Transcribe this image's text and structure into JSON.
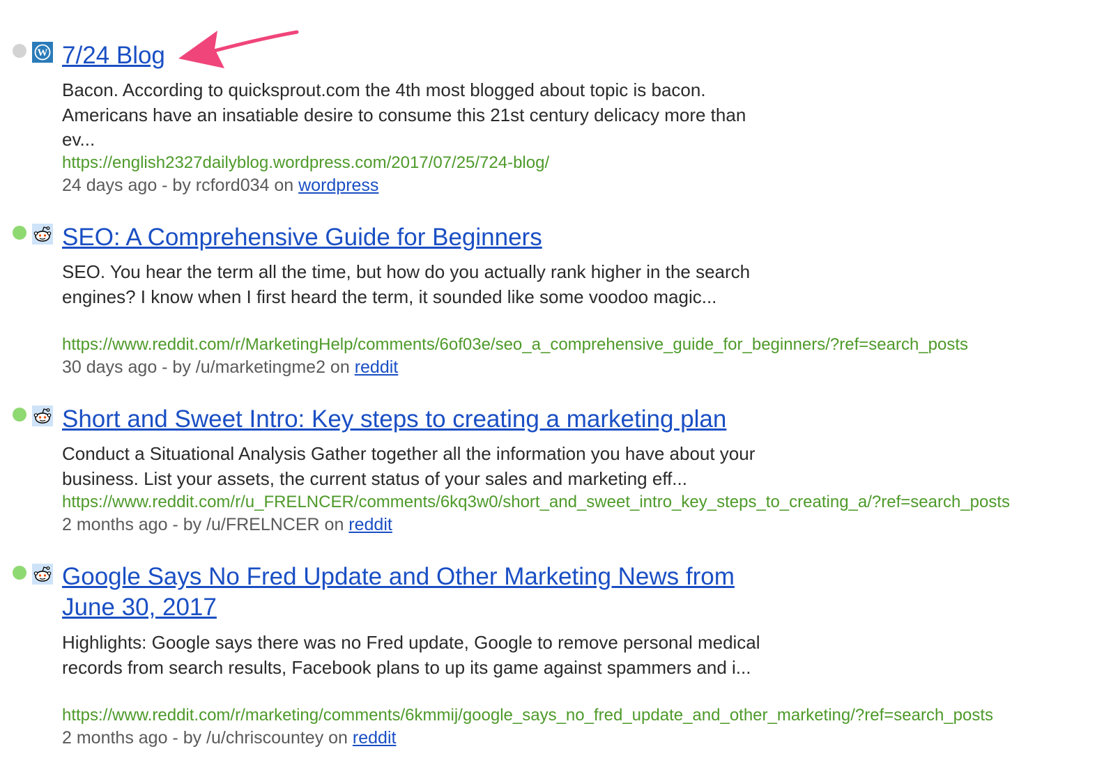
{
  "colors": {
    "title_link": "#1a4fc4",
    "url_green": "#4e9a2a",
    "dot_green": "#8fd972",
    "dot_grey": "#d3d3d3",
    "annotation_arrow": "#f0457a"
  },
  "results": [
    {
      "status": "grey",
      "source_icon": "wordpress-icon",
      "title": "7/24 Blog",
      "snippet": "Bacon. According to quicksprout.com the 4th most blogged about topic is bacon. Americans have an insatiable desire to consume this 21st century delicacy more than ev...",
      "url": "https://english2327dailyblog.wordpress.com/2017/07/25/724-blog/",
      "meta_prefix": "24 days ago - by rcford034 on ",
      "source_link": "wordpress"
    },
    {
      "status": "green",
      "source_icon": "reddit-icon",
      "title": "SEO: A Comprehensive Guide for Beginners",
      "snippet": "SEO. You hear the term all the time, but how do you actually rank higher in the search engines? I know when I first heard the term, it sounded like some voodoo magic...",
      "url": "https://www.reddit.com/r/MarketingHelp/comments/6of03e/seo_a_comprehensive_guide_for_beginners/?ref=search_posts",
      "meta_prefix": "30 days ago - by /u/marketingme2 on ",
      "source_link": "reddit"
    },
    {
      "status": "green",
      "source_icon": "reddit-icon",
      "title": "Short and Sweet Intro: Key steps to creating a marketing plan",
      "snippet": "Conduct a Situational Analysis Gather together all the information you have about your business. List your assets, the current status of your sales and marketing eff...",
      "url": "https://www.reddit.com/r/u_FRELNCER/comments/6kq3w0/short_and_sweet_intro_key_steps_to_creating_a/?ref=search_posts",
      "meta_prefix": "2 months ago - by /u/FRELNCER on ",
      "source_link": "reddit"
    },
    {
      "status": "green",
      "source_icon": "reddit-icon",
      "title_line1": "Google Says No Fred Update and Other Marketing News from",
      "title_line2": "June 30, 2017",
      "snippet": "Highlights: Google says there was no Fred update, Google to remove personal medical records from search results, Facebook plans to up its game against spammers and i...",
      "url": "https://www.reddit.com/r/marketing/comments/6kmmij/google_says_no_fred_update_and_other_marketing/?ref=search_posts",
      "meta_prefix": "2 months ago - by /u/chriscountey on ",
      "source_link": "reddit"
    }
  ]
}
